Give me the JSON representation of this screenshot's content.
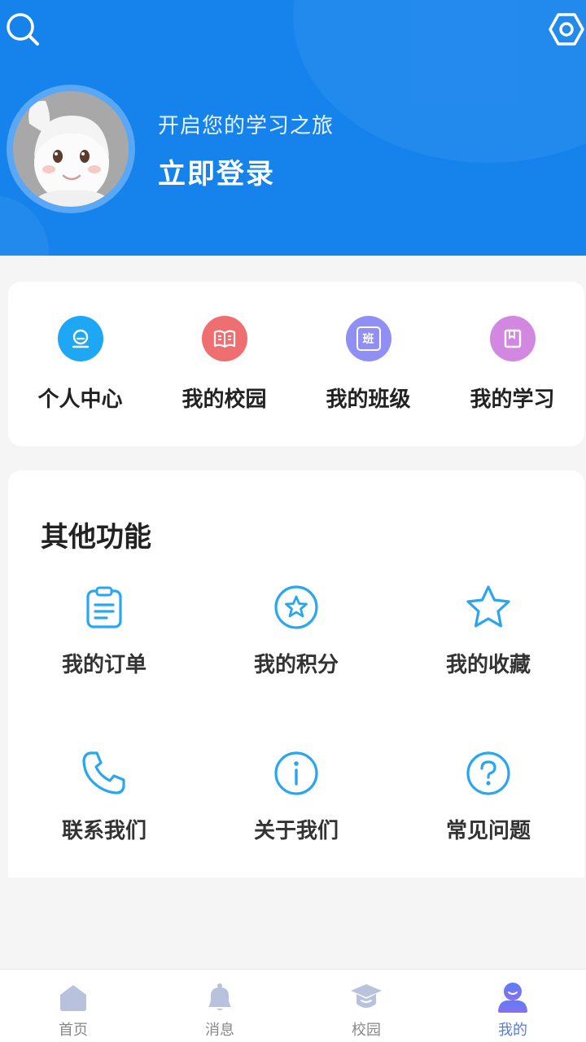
{
  "header": {
    "greeting": "开启您的学习之旅",
    "login_label": "立即登录",
    "search_icon": "search-icon",
    "settings_icon": "settings-hex-icon",
    "bg_color": "#1683ec"
  },
  "quick_nav": [
    {
      "label": "个人中心",
      "icon": "profile-icon",
      "color": "#1ea7f5"
    },
    {
      "label": "我的校园",
      "icon": "book-open-icon",
      "color": "#ef6f70"
    },
    {
      "label": "我的班级",
      "icon": "class-icon",
      "color": "#8f8ff5"
    },
    {
      "label": "我的学习",
      "icon": "notebook-icon",
      "color": "#d287e0"
    }
  ],
  "other": {
    "title": "其他功能",
    "items": [
      {
        "label": "我的订单",
        "icon": "clipboard-icon"
      },
      {
        "label": "我的积分",
        "icon": "star-badge-icon"
      },
      {
        "label": "我的收藏",
        "icon": "star-icon"
      },
      {
        "label": "联系我们",
        "icon": "phone-icon"
      },
      {
        "label": "关于我们",
        "icon": "info-icon"
      },
      {
        "label": "常见问题",
        "icon": "question-icon"
      }
    ],
    "icon_color": "#2aa6f0"
  },
  "tabbar": [
    {
      "label": "首页",
      "icon": "home-icon",
      "active": false
    },
    {
      "label": "消息",
      "icon": "bell-icon",
      "active": false
    },
    {
      "label": "校园",
      "icon": "graduation-cap-icon",
      "active": false
    },
    {
      "label": "我的",
      "icon": "user-icon",
      "active": true
    }
  ],
  "class_icon_text": "班"
}
